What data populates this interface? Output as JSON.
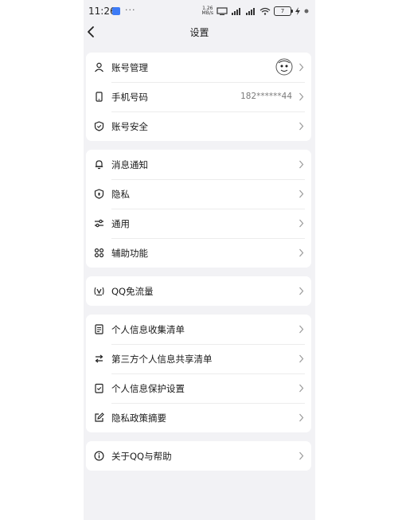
{
  "status_bar": {
    "time": "11:26",
    "dots": "···",
    "net_speed_value": "1.26",
    "net_speed_unit": "MB/s",
    "battery": "7"
  },
  "nav": {
    "title": "设置"
  },
  "groups": [
    {
      "items": [
        {
          "label": "账号管理",
          "icon": "person-icon",
          "avatar": true
        },
        {
          "label": "手机号码",
          "icon": "phone-icon",
          "value": "182******44"
        },
        {
          "label": "账号安全",
          "icon": "shield-check-icon"
        }
      ]
    },
    {
      "items": [
        {
          "label": "消息通知",
          "icon": "bell-icon"
        },
        {
          "label": "隐私",
          "icon": "shield-lock-icon"
        },
        {
          "label": "通用",
          "icon": "sliders-icon"
        },
        {
          "label": "辅助功能",
          "icon": "grid-icon"
        }
      ]
    },
    {
      "items": [
        {
          "label": "QQ免流量",
          "icon": "signal-icon"
        }
      ]
    },
    {
      "items": [
        {
          "label": "个人信息收集清单",
          "icon": "document-icon"
        },
        {
          "label": "第三方个人信息共享清单",
          "icon": "share-icon"
        },
        {
          "label": "个人信息保护设置",
          "icon": "protect-icon"
        },
        {
          "label": "隐私政策摘要",
          "icon": "edit-icon"
        }
      ]
    },
    {
      "items": [
        {
          "label": "关于QQ与帮助",
          "icon": "info-icon"
        }
      ]
    }
  ]
}
